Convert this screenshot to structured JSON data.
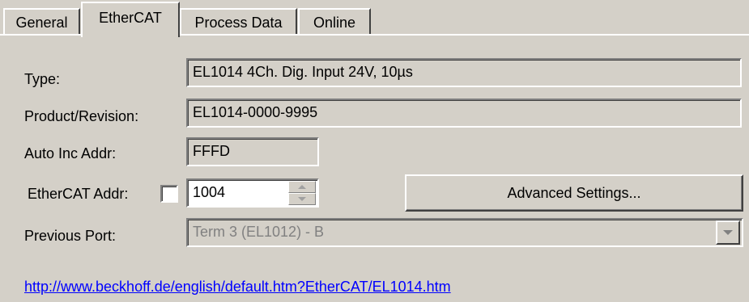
{
  "tabs": [
    {
      "label": "General",
      "active": false
    },
    {
      "label": "EtherCAT",
      "active": true
    },
    {
      "label": "Process Data",
      "active": false
    },
    {
      "label": "Online",
      "active": false
    }
  ],
  "form": {
    "type": {
      "label": "Type:",
      "value": "EL1014 4Ch. Dig. Input 24V, 10µs"
    },
    "product_revision": {
      "label": "Product/Revision:",
      "value": "EL1014-0000-9995"
    },
    "auto_inc_addr": {
      "label": "Auto Inc Addr:",
      "value": "FFFD"
    },
    "ethercat_addr": {
      "label": "EtherCAT Addr:",
      "checked": false,
      "value": "1004"
    },
    "advanced_settings_label": "Advanced Settings...",
    "previous_port": {
      "label": "Previous Port:",
      "value": "Term 3 (EL1012) - B"
    }
  },
  "link": {
    "text": "http://www.beckhoff.de/english/default.htm?EtherCAT/EL1014.htm"
  },
  "icons": {
    "spinner_up": "chevron-up-icon",
    "spinner_down": "chevron-down-icon",
    "combo_arrow": "dropdown-arrow-icon"
  },
  "colors": {
    "face": "#d4d0c8",
    "link": "#0000ff",
    "disabled_text": "#808080"
  }
}
